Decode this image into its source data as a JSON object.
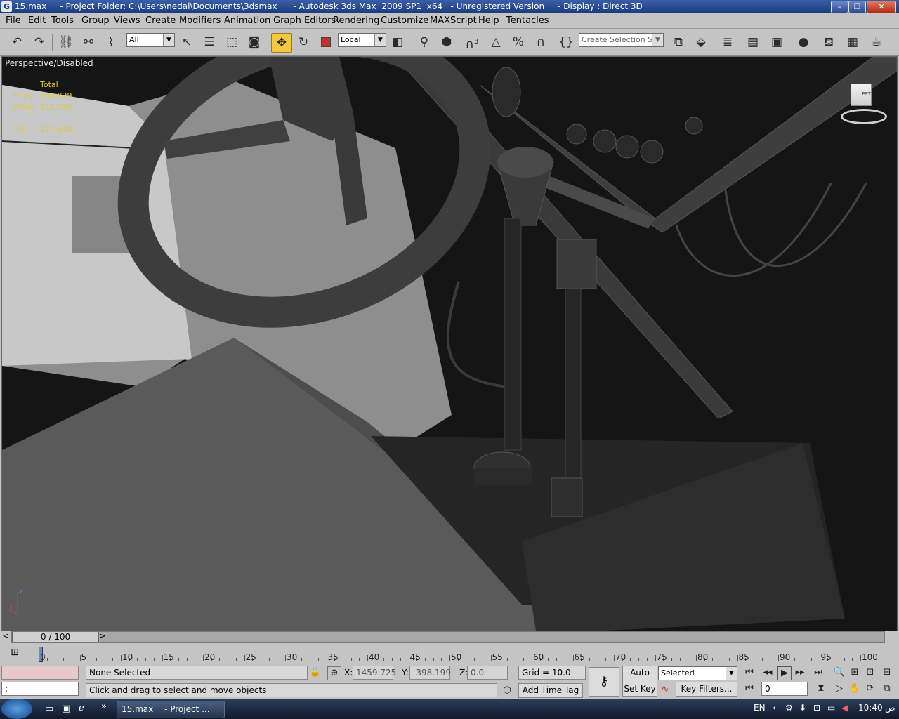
{
  "window": {
    "title": "15.max     - Project Folder: C:\\Users\\nedal\\Documents\\3dsmax      - Autodesk 3ds Max  2009 SP1  x64   - Unregistered Version     - Display : Direct 3D"
  },
  "menu": [
    "File",
    "Edit",
    "Tools",
    "Group",
    "Views",
    "Create",
    "Modifiers",
    "Animation",
    "Graph Editors",
    "Rendering",
    "Customize",
    "MAXScript",
    "Help",
    "Tentacles"
  ],
  "toolbar": {
    "selection_filter": "All",
    "ref_coord": "Local",
    "named_selection_placeholder": "Create Selection Set",
    "snap_angle_label": "3"
  },
  "viewport": {
    "label": "Perspective/Disabled",
    "stats": {
      "total_label": "Total",
      "polys_label": "Polys:",
      "polys_value": "181,829",
      "verts_label": "Verts:",
      "verts_value": "113,789",
      "fps_label": "FPS:",
      "fps_value": "227,446"
    },
    "viewcube_label": "LEFT"
  },
  "timeline": {
    "frame_display": "0 / 100",
    "ticks": [
      "0",
      "5",
      "10",
      "15",
      "20",
      "25",
      "30",
      "35",
      "40",
      "45",
      "50",
      "55",
      "60",
      "65",
      "70",
      "75",
      "80",
      "85",
      "90",
      "95",
      "100"
    ]
  },
  "status": {
    "selection": "None Selected",
    "prompt": "Click and drag to select and move objects",
    "maxscript_prompt": ":",
    "x_label": "X:",
    "x_value": "1459.725",
    "y_label": "Y:",
    "y_value": "-398.199",
    "z_label": "Z:",
    "z_value": "0.0",
    "grid": "Grid = 10.0",
    "add_time_tag": "Add Time Tag",
    "auto_key": "Auto Key",
    "set_key": "Set Key",
    "key_mode": "Selected",
    "key_filters": "Key Filters...",
    "current_frame": "0"
  },
  "taskbar": {
    "items": [
      "15.max",
      "- Project ..."
    ],
    "language": "EN",
    "clock": "10:40",
    "clock_suffix": "ص"
  },
  "colors": {
    "title_bar": "#1a3a7c",
    "ui_gray": "#c4c4c4",
    "active_tool": "#f5c842",
    "stats_text": "#e0c840"
  }
}
